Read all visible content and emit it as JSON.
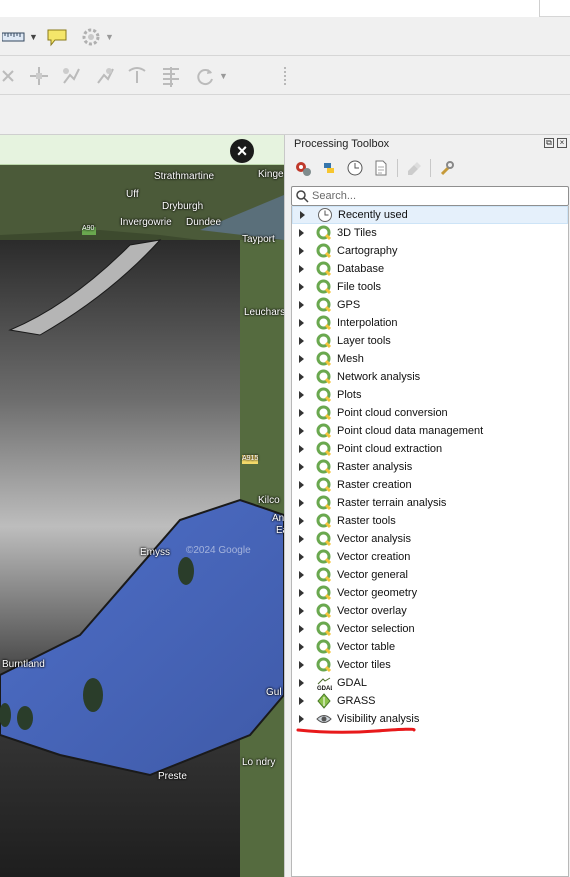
{
  "map": {
    "labels": [
      "Strathmartine",
      "Kinge",
      "Dryburgh",
      "Invergowrie",
      "Dundee",
      "Tayport",
      "A90",
      "Uff",
      "Leuchars",
      "A915",
      "Kilco",
      "Ang",
      "Earl",
      "Emyss",
      "©2024 Google",
      "Gul",
      "Preste",
      "Lo  ndry",
      "Burntland"
    ],
    "close_symbol": "×"
  },
  "panel": {
    "title": "Processing Toolbox",
    "float_symbol": "⧉",
    "close_symbol": "×",
    "search_placeholder": "Search...",
    "items": [
      {
        "label": "Recently used",
        "icon": "clock-icon"
      },
      {
        "label": "3D Tiles",
        "icon": "qgis-icon"
      },
      {
        "label": "Cartography",
        "icon": "qgis-icon"
      },
      {
        "label": "Database",
        "icon": "qgis-icon"
      },
      {
        "label": "File tools",
        "icon": "qgis-icon"
      },
      {
        "label": "GPS",
        "icon": "qgis-icon"
      },
      {
        "label": "Interpolation",
        "icon": "qgis-icon"
      },
      {
        "label": "Layer tools",
        "icon": "qgis-icon"
      },
      {
        "label": "Mesh",
        "icon": "qgis-icon"
      },
      {
        "label": "Network analysis",
        "icon": "qgis-icon"
      },
      {
        "label": "Plots",
        "icon": "qgis-icon"
      },
      {
        "label": "Point cloud conversion",
        "icon": "qgis-icon"
      },
      {
        "label": "Point cloud data management",
        "icon": "qgis-icon"
      },
      {
        "label": "Point cloud extraction",
        "icon": "qgis-icon"
      },
      {
        "label": "Raster analysis",
        "icon": "qgis-icon"
      },
      {
        "label": "Raster creation",
        "icon": "qgis-icon"
      },
      {
        "label": "Raster terrain analysis",
        "icon": "qgis-icon"
      },
      {
        "label": "Raster tools",
        "icon": "qgis-icon"
      },
      {
        "label": "Vector analysis",
        "icon": "qgis-icon"
      },
      {
        "label": "Vector creation",
        "icon": "qgis-icon"
      },
      {
        "label": "Vector general",
        "icon": "qgis-icon"
      },
      {
        "label": "Vector geometry",
        "icon": "qgis-icon"
      },
      {
        "label": "Vector overlay",
        "icon": "qgis-icon"
      },
      {
        "label": "Vector selection",
        "icon": "qgis-icon"
      },
      {
        "label": "Vector table",
        "icon": "qgis-icon"
      },
      {
        "label": "Vector tiles",
        "icon": "qgis-icon"
      },
      {
        "label": "GDAL",
        "icon": "gdal-icon"
      },
      {
        "label": "GRASS",
        "icon": "grass-icon"
      },
      {
        "label": "Visibility analysis",
        "icon": "eye-icon"
      }
    ]
  },
  "colors": {
    "qgis_green": "#6aa84f",
    "annotation_red": "#e8191b",
    "selection": "#e5f0fb"
  }
}
